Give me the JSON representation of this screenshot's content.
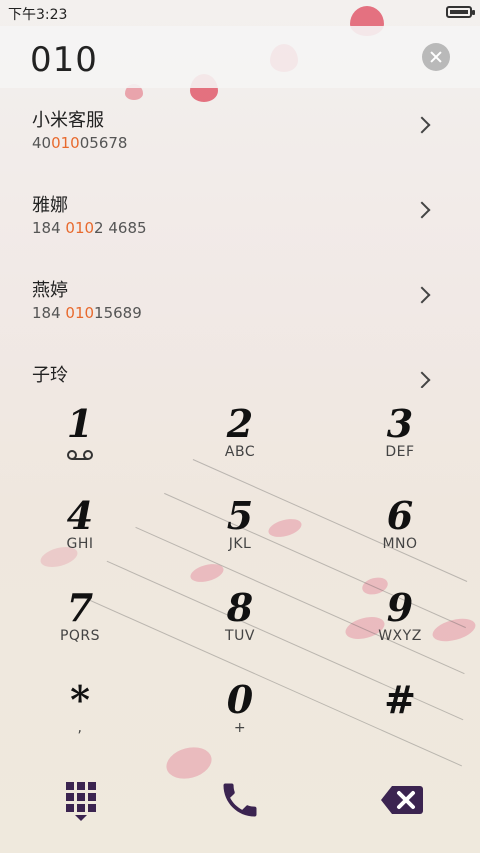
{
  "status_bar": {
    "time": "下午3:23"
  },
  "number_display": {
    "number": "010"
  },
  "results": [
    {
      "name": "小米客服",
      "number_pre": "40",
      "number_match": "010",
      "number_post": "05678"
    },
    {
      "name": "雅娜",
      "number_pre": "184 ",
      "number_match": "010",
      "number_post": "2 4685"
    },
    {
      "name": "燕婷",
      "number_pre": "184 ",
      "number_match": "010",
      "number_post": "15689"
    },
    {
      "name": "子玲",
      "number_pre": "",
      "number_match": "",
      "number_post": ""
    }
  ],
  "keypad": [
    {
      "digit": "1",
      "letters": ""
    },
    {
      "digit": "2",
      "letters": "ABC"
    },
    {
      "digit": "3",
      "letters": "DEF"
    },
    {
      "digit": "4",
      "letters": "GHI"
    },
    {
      "digit": "5",
      "letters": "JKL"
    },
    {
      "digit": "6",
      "letters": "MNO"
    },
    {
      "digit": "7",
      "letters": "PQRS"
    },
    {
      "digit": "8",
      "letters": "TUV"
    },
    {
      "digit": "9",
      "letters": "WXYZ"
    },
    {
      "digit": "*",
      "letters": ","
    },
    {
      "digit": "0",
      "letters": "+"
    },
    {
      "digit": "#",
      "letters": ""
    }
  ],
  "bottom_bar": {
    "keypad_icon": "dialpad-icon",
    "call_icon": "phone-icon",
    "backspace_icon": "backspace-icon"
  },
  "colors": {
    "highlight": "#e86a2e",
    "accent": "#3b2450"
  }
}
